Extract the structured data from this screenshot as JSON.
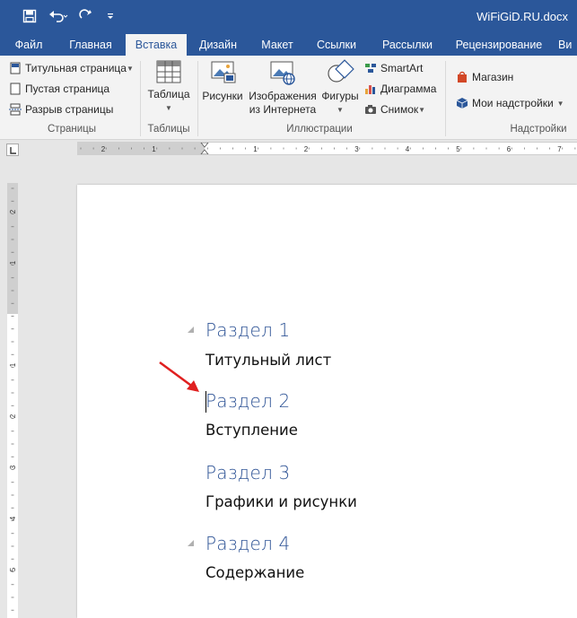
{
  "window": {
    "title": "WiFiGiD.RU.docx"
  },
  "quick_access": [
    {
      "name": "save-icon"
    },
    {
      "name": "undo-icon"
    },
    {
      "name": "redo-icon"
    },
    {
      "name": "customize-icon"
    }
  ],
  "tabs": [
    {
      "label": "Файл"
    },
    {
      "label": "Главная"
    },
    {
      "label": "Вставка",
      "active": true
    },
    {
      "label": "Дизайн"
    },
    {
      "label": "Макет"
    },
    {
      "label": "Ссылки"
    },
    {
      "label": "Рассылки"
    },
    {
      "label": "Рецензирование"
    },
    {
      "label": "Ви"
    }
  ],
  "ribbon": {
    "pages": {
      "cover_page": "Титульная страница",
      "blank_page": "Пустая страница",
      "page_break": "Разрыв страницы",
      "group_label": "Страницы"
    },
    "tables": {
      "table_line1": "Таблица",
      "group_label": "Таблицы"
    },
    "illustrations": {
      "pictures": "Рисунки",
      "online_line1": "Изображения",
      "online_line2": "из Интернета",
      "shapes": "Фигуры",
      "smartart": "SmartArt",
      "chart": "Диаграмма",
      "screenshot": "Снимок",
      "group_label": "Иллюстрации"
    },
    "addins": {
      "store": "Магазин",
      "my_addins": "Мои надстройки",
      "group_label": "Надстройки"
    }
  },
  "rulers": {
    "horizontal_numbers": [
      "2",
      "1",
      "1",
      "2",
      "3",
      "4",
      "5",
      "6",
      "7"
    ],
    "vertical_numbers": [
      "2",
      "1",
      "1",
      "2",
      "3",
      "4",
      "5",
      "6"
    ]
  },
  "document": {
    "sections": [
      {
        "heading": "Раздел 1",
        "text": "Титульный лист",
        "collapse_marker": true
      },
      {
        "heading": "Раздел 2",
        "text": "Вступление",
        "collapse_marker": false
      },
      {
        "heading": "Раздел 3",
        "text": "Графики и рисунки",
        "collapse_marker": false
      },
      {
        "heading": "Раздел 4",
        "text": "Содержание",
        "collapse_marker": true
      }
    ]
  },
  "colors": {
    "accent": "#2b579a",
    "heading": "#2f5496",
    "annotation_arrow": "#e02020"
  }
}
